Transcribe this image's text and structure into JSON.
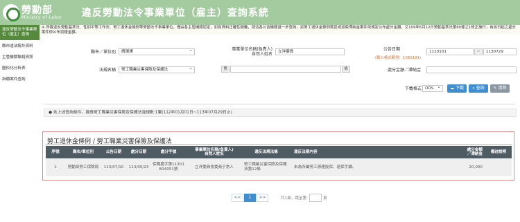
{
  "header": {
    "logo_zh": "勞動部",
    "logo_en": "Ministry of Labor",
    "title": "違反勞動法令事業單位（雇主）查詢系統"
  },
  "notice": "※ 所載違反勞動基準法、性別平等工作法、勞工退休金條例等勞動法令事業單位，僅由各主管機關認定，如有資料正確性疑義，請洽各公告機關進一步查詢，另勞工退休金條例裁罰或加徵滯納金案件依規定公布處分金額，又109年6月12日勞動基準法第80條之1修正施行，自該日起之處分案件依公布罰鍰金額。",
  "sidebar": {
    "items": [
      "違反勞動法令事業單位（雇主）查詢",
      "縣市違法統計資料",
      "主管機關聯絡資訊",
      "圖形化分析表",
      "訴願案件查詢"
    ]
  },
  "form": {
    "county_label": "縣市／單位別",
    "county_value": "請選擇",
    "company_label": "事業單位名稱(負責人)\n自然人姓名",
    "company_value": "立洋委員",
    "date_label": "公告日期",
    "date_from": "1120101",
    "date_sep": "~",
    "date_to": "1130729",
    "date_hint": "(輸入格式範例：1060101)",
    "law_label": "法規名稱",
    "law_value": "勞工職業災害保險及保護法",
    "law_addon_left": "第",
    "law_addon_right": "條",
    "amount_label": "處分金額／滯納金",
    "download_label": "下載格式",
    "download_value": "ODS"
  },
  "buttons": {
    "download": "下載",
    "search": "查詢",
    "clear": "清除"
  },
  "summary": "依上述查詢條件，搜尋勞工職業災害保險及保護法違規數:1筆(112年01月01日~113年07月29日止)",
  "section_title": "勞工退休金條例 / 勞工職業災害保險及保護法",
  "table": {
    "headers": [
      "序號",
      "縣市/單位別",
      "公告日期",
      "處分日期",
      "處分字號",
      "事業單位名稱(負責人)\n自然人姓名",
      "違反法規法條",
      "違反法規內容",
      "處分金額\n／滯納金",
      "備註說明"
    ],
    "rows": [
      [
        "1",
        "勞動部勞工保險局",
        "113/07/10",
        "113/05/23",
        "保職農字第11301804051號",
        "立洋委員會委員于常人",
        "勞工職業災害保險及保護法第12條",
        "未為所屬勞工辦理投保、退保手續。",
        "20,000",
        ""
      ]
    ]
  },
  "pager": {
    "prev": "<<",
    "current": "1",
    "next": ">>",
    "info": "共1頁，跳至第",
    "tail": "頁"
  },
  "colors": {
    "header_bg": "#a4caa0",
    "sidebar_active": "#558a3d",
    "table_head": "#4e5b63",
    "button_blue": "#3d8fd1",
    "button_gray": "#8a96a2",
    "frame_red": "#d88a8a"
  }
}
